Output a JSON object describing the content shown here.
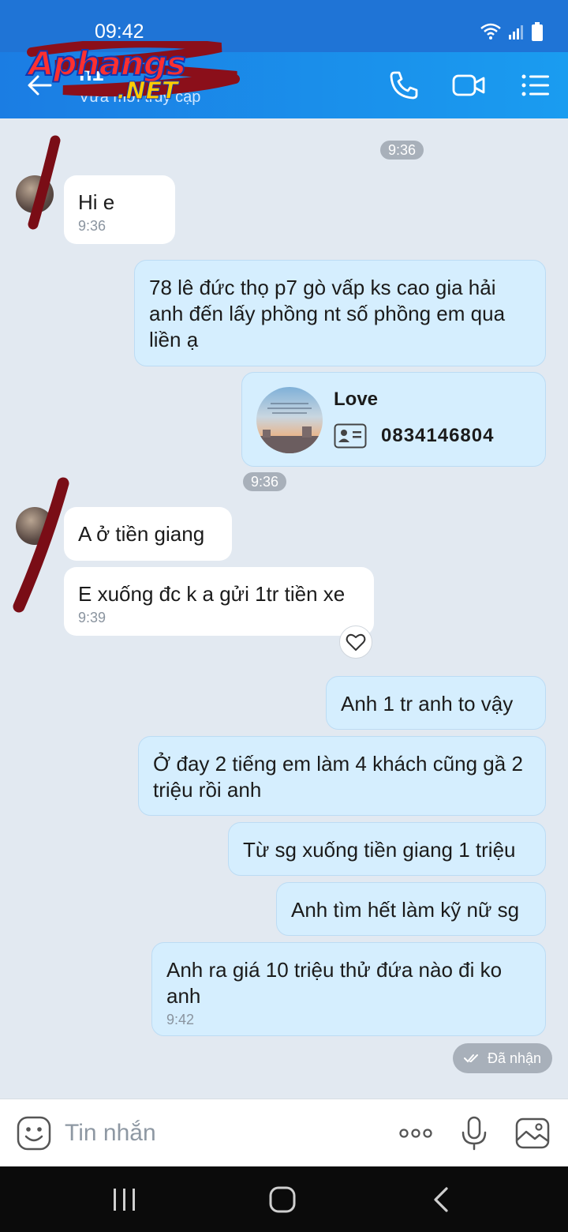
{
  "status_bar": {
    "time": "09:42"
  },
  "header": {
    "name": "h1",
    "status": "Vừa mới truy cập",
    "icons": [
      "back-arrow-icon",
      "phone-icon",
      "video-icon",
      "menu-icon"
    ]
  },
  "watermark": {
    "main": "Aphangs",
    "sub": ".NET"
  },
  "chat": {
    "time_pill_1": "9:36",
    "time_pill_2": "9:36",
    "msg_hi": {
      "text": "Hi e",
      "time": "9:36"
    },
    "msg_address": {
      "text": "78 lê đức thọ p7 gò vấp ks cao gia hải anh đến lấy phồng nt số phồng em qua liền ạ"
    },
    "contact_card": {
      "name": "Love",
      "phone": "0834146804"
    },
    "msg_tiengiang": {
      "text": "A ở tiền giang"
    },
    "msg_xuong": {
      "text": "E xuống đc k a gửi 1tr tiền xe",
      "time": "9:39"
    },
    "msg_1tr": {
      "text": "Anh 1 tr  anh to vậy"
    },
    "msg_2tieng": {
      "text": "Ở đay 2 tiếng em làm 4 khách cũng gầ 2 triệu rồi anh"
    },
    "msg_tusg": {
      "text": "Từ sg xuống tiền giang 1 triệu"
    },
    "msg_anhtim": {
      "text": "Anh tìm hết làm kỹ nữ sg"
    },
    "msg_anhra": {
      "text": "Anh ra  giá 10 triệu thử đứa nào đi ko anh",
      "time": "9:42"
    },
    "received_label": "Đã nhận"
  },
  "input": {
    "placeholder": "Tin nhắn"
  },
  "colors": {
    "header": "#1b7de3",
    "bubble_out": "#d5eefe",
    "bubble_in": "#ffffff",
    "background": "#e2e9f1"
  }
}
